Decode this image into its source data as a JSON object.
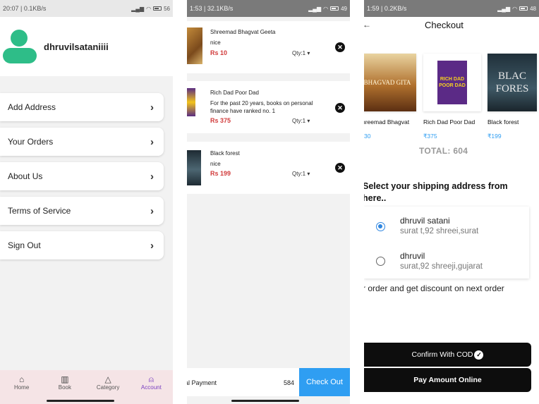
{
  "account_screen": {
    "status_time": "20:07 | 0.1KB/s",
    "status_right": "56",
    "username": "dhruvilsataniiii",
    "menu": [
      {
        "label": "Add Address"
      },
      {
        "label": "Your Orders"
      },
      {
        "label": "About Us"
      },
      {
        "label": "Terms of Service"
      },
      {
        "label": "Sign Out"
      }
    ],
    "nav": [
      {
        "label": "Home",
        "icon": "home-icon"
      },
      {
        "label": "Book",
        "icon": "book-icon"
      },
      {
        "label": "Category",
        "icon": "category-icon"
      },
      {
        "label": "Account",
        "icon": "account-icon"
      }
    ],
    "active_color": "#7a3fc0"
  },
  "cart_screen": {
    "status_time": "1:53 | 32.1KB/s",
    "status_right": "49",
    "items": [
      {
        "title": "Shreemad Bhagvat Geeta",
        "desc": "nice",
        "price": "Rs 10",
        "qty": "Qty:1 ▾"
      },
      {
        "title": "Rich Dad Poor Dad",
        "desc": "For the past 20 years, books on personal finance have ranked no. 1",
        "price": "Rs 375",
        "qty": "Qty:1 ▾"
      },
      {
        "title": "Black forest",
        "desc": "nice",
        "price": "Rs 199",
        "qty": "Qty:1 ▾"
      }
    ],
    "payment_label": "al Payment",
    "payment_amount": "584",
    "checkout_label": "Check Out",
    "price_color": "#d13b3b",
    "accent_color": "#2f9ef2"
  },
  "checkout_screen": {
    "status_time": "1:59 | 0.2KB/s",
    "status_right": "48",
    "title": "Checkout",
    "books": [
      {
        "name": "hreemad Bhagvat",
        "price": "30",
        "cover_text": "BHAGVAD GITA"
      },
      {
        "name": "Rich Dad Poor Dad",
        "price": "₹375",
        "cover_text": "RICH DAD POOR DAD"
      },
      {
        "name": "Black forest",
        "price": "₹199",
        "cover_text": "BLAC FORES"
      }
    ],
    "total": "TOTAL: 604",
    "ship_heading": "Select your shipping address from here..",
    "addresses": [
      {
        "name": "dhruvil satani",
        "detail": "surat t,92 shreei,surat",
        "selected": true
      },
      {
        "name": "dhruvil",
        "detail": "surat,92 shreeji,gujarat",
        "selected": false
      }
    ],
    "discount_text": "r order and get discount on next order",
    "cod_label": "Confirm With COD",
    "online_label": "Pay Amount Online"
  }
}
